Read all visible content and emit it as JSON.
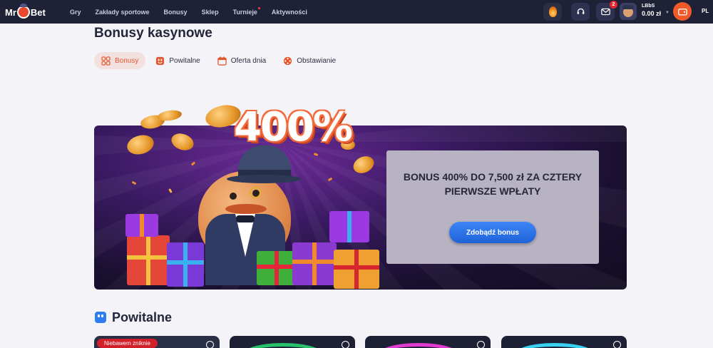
{
  "header": {
    "logo_text_left": "Mr",
    "logo_text_right": "Bet",
    "nav": [
      {
        "label": "Gry"
      },
      {
        "label": "Zakłady sportowe"
      },
      {
        "label": "Bonusy"
      },
      {
        "label": "Sklep"
      },
      {
        "label": "Turnieje"
      },
      {
        "label": "Aktywności"
      }
    ],
    "mail_badge": "2",
    "username": "LBbS",
    "balance": "0.00 zł",
    "language": "PL"
  },
  "page": {
    "title": "Bonusy kasynowe",
    "tabs": [
      {
        "label": "Bonusy",
        "active": true
      },
      {
        "label": "Powitalne",
        "active": false
      },
      {
        "label": "Oferta dnia",
        "active": false
      },
      {
        "label": "Obstawianie",
        "active": false
      }
    ]
  },
  "banner": {
    "hero_text": "400%",
    "headline": "BONUS 400% DO 7,500 zł ZA CZTERY PIERWSZE WPŁATY",
    "cta_label": "Zdobądź bonus"
  },
  "section": {
    "title": "Powitalne",
    "cards": [
      {
        "tag": "Niebawem zniknie"
      },
      {
        "tag": ""
      },
      {
        "tag": ""
      },
      {
        "tag": ""
      }
    ]
  },
  "colors": {
    "topbar": "#1f2237",
    "accent": "#e4572e",
    "cta_blue": "#2a6fe6",
    "page_bg": "#f4f4f8"
  }
}
